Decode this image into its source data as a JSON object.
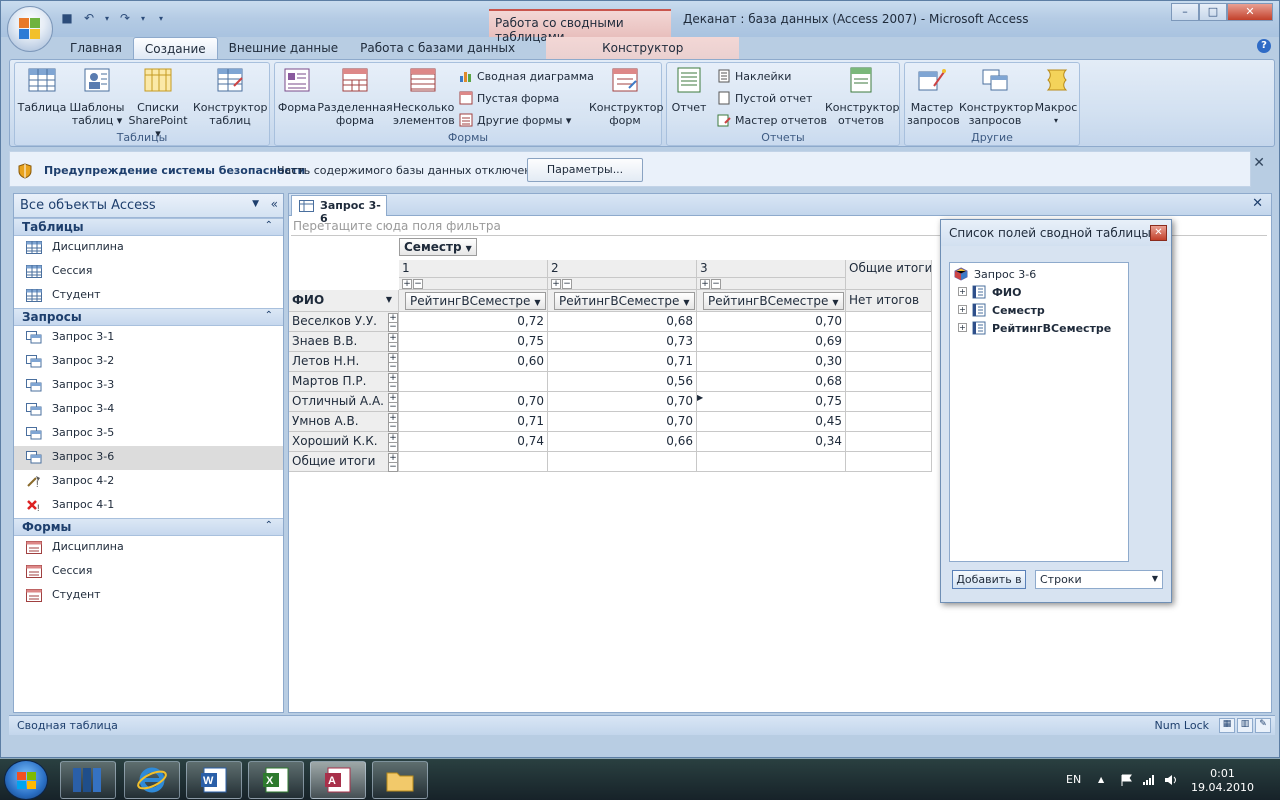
{
  "window": {
    "app_title": "Деканат : база данных (Access 2007)  -  Microsoft Access",
    "context_tab_header": "Работа со сводными таблицами",
    "controls": [
      "–",
      "□",
      "✕"
    ]
  },
  "ribbon": {
    "tabs": [
      "Главная",
      "Создание",
      "Внешние данные",
      "Работа с базами данных",
      "Конструктор"
    ],
    "active_tab": "Создание",
    "groups": {
      "tables": {
        "label": "Таблицы",
        "buttons": [
          {
            "l1": "Таблица",
            "l2": ""
          },
          {
            "l1": "Шаблоны",
            "l2": "таблиц ▾"
          },
          {
            "l1": "Списки",
            "l2": "SharePoint ▾"
          },
          {
            "l1": "Конструктор",
            "l2": "таблиц"
          }
        ]
      },
      "forms": {
        "label": "Формы",
        "buttons": [
          {
            "l1": "Форма",
            "l2": ""
          },
          {
            "l1": "Разделенная",
            "l2": "форма"
          },
          {
            "l1": "Несколько",
            "l2": "элементов"
          },
          {
            "l1": "Конструктор",
            "l2": "форм"
          }
        ],
        "small": [
          "Сводная диаграмма",
          "Пустая форма",
          "Другие формы ▾"
        ]
      },
      "reports": {
        "label": "Отчеты",
        "buttons": [
          {
            "l1": "Отчет",
            "l2": ""
          },
          {
            "l1": "Конструктор",
            "l2": "отчетов"
          }
        ],
        "small": [
          "Наклейки",
          "Пустой отчет",
          "Мастер отчетов"
        ]
      },
      "other": {
        "label": "Другие",
        "buttons": [
          {
            "l1": "Мастер",
            "l2": "запросов"
          },
          {
            "l1": "Конструктор",
            "l2": "запросов"
          },
          {
            "l1": "Макрос",
            "l2": "▾"
          }
        ]
      }
    }
  },
  "security_bar": {
    "title": "Предупреждение системы безопасности",
    "message": "Часть содержимого базы данных отключено",
    "button": "Параметры..."
  },
  "nav": {
    "header": "Все объекты Access",
    "sections": [
      {
        "title": "Таблицы",
        "items": [
          "Дисциплина",
          "Сессия",
          "Студент"
        ]
      },
      {
        "title": "Запросы",
        "items": [
          "Запрос 3-1",
          "Запрос 3-2",
          "Запрос 3-3",
          "Запрос 3-4",
          "Запрос 3-5",
          "Запрос 3-6",
          "Запрос 4-2",
          "Запрос 4-1"
        ]
      },
      {
        "title": "Формы",
        "items": [
          "Дисциплина",
          "Сессия",
          "Студент"
        ]
      }
    ],
    "selected": "Запрос 3-6"
  },
  "document": {
    "tab": "Запрос 3-6",
    "filter_placeholder": "Перетащите сюда поля фильтра",
    "column_field": "Семестр",
    "row_field": "ФИО",
    "semesters": [
      "1",
      "2",
      "3"
    ],
    "grand_total_col": "Общие итоги",
    "data_field": "РейтингВСеместре",
    "no_totals": "Нет итогов",
    "grand_total_row": "Общие итоги",
    "rows": [
      {
        "name": "Веселков У.У.",
        "v": [
          "0,72",
          "0,68",
          "0,70"
        ]
      },
      {
        "name": "Знаев В.В.",
        "v": [
          "0,75",
          "0,73",
          "0,69"
        ]
      },
      {
        "name": "Летов Н.Н.",
        "v": [
          "0,60",
          "0,71",
          "0,30"
        ]
      },
      {
        "name": "Мартов П.Р.",
        "v": [
          "",
          "0,56",
          "0,68"
        ]
      },
      {
        "name": "Отличный А.А.",
        "v": [
          "0,70",
          "0,70",
          "0,75"
        ]
      },
      {
        "name": "Умнов А.В.",
        "v": [
          "0,71",
          "0,70",
          "0,45"
        ]
      },
      {
        "name": "Хороший К.К.",
        "v": [
          "0,74",
          "0,66",
          "0,34"
        ]
      }
    ]
  },
  "field_list": {
    "title": "Список полей сводной таблицы",
    "root": "Запрос 3-6",
    "fields": [
      "ФИО",
      "Семестр",
      "РейтингВСеместре"
    ],
    "add_button": "Добавить в",
    "area_select": "Строки"
  },
  "status": {
    "left": "Сводная таблица",
    "right": "Num Lock"
  },
  "taskbar": {
    "lang": "EN",
    "time": "0:01",
    "date": "19.04.2010"
  }
}
